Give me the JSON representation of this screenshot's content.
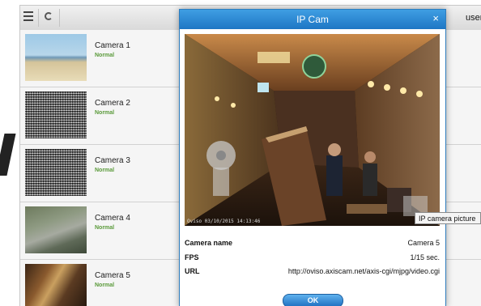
{
  "toolbar": {
    "menu_icon": "hamburger-menu-icon",
    "refresh_icon": "refresh-icon",
    "username_label": "username: c"
  },
  "cameras": [
    {
      "name": "Camera 1",
      "status": "Normal"
    },
    {
      "name": "Camera 2",
      "status": "Normal"
    },
    {
      "name": "Camera 3",
      "status": "Normal"
    },
    {
      "name": "Camera 4",
      "status": "Normal"
    },
    {
      "name": "Camera 5",
      "status": "Normal"
    }
  ],
  "modal": {
    "title": "IP Cam",
    "close_label": "×",
    "image_caption": "Oviso 03/10/2015 14:13:46",
    "fields": [
      {
        "label": "Camera name",
        "value": "Camera 5"
      },
      {
        "label": "FPS",
        "value": "1/15 sec."
      },
      {
        "label": "URL",
        "value": "http://oviso.axiscam.net/axis-cgi/mjpg/video.cgi"
      }
    ],
    "ok_label": "OK"
  },
  "tooltip": {
    "text": "IP camera picture"
  },
  "colors": {
    "header_blue": "#2f8ad6",
    "status_green": "#5a9a3a",
    "ok_button": "#3a8fd8"
  }
}
